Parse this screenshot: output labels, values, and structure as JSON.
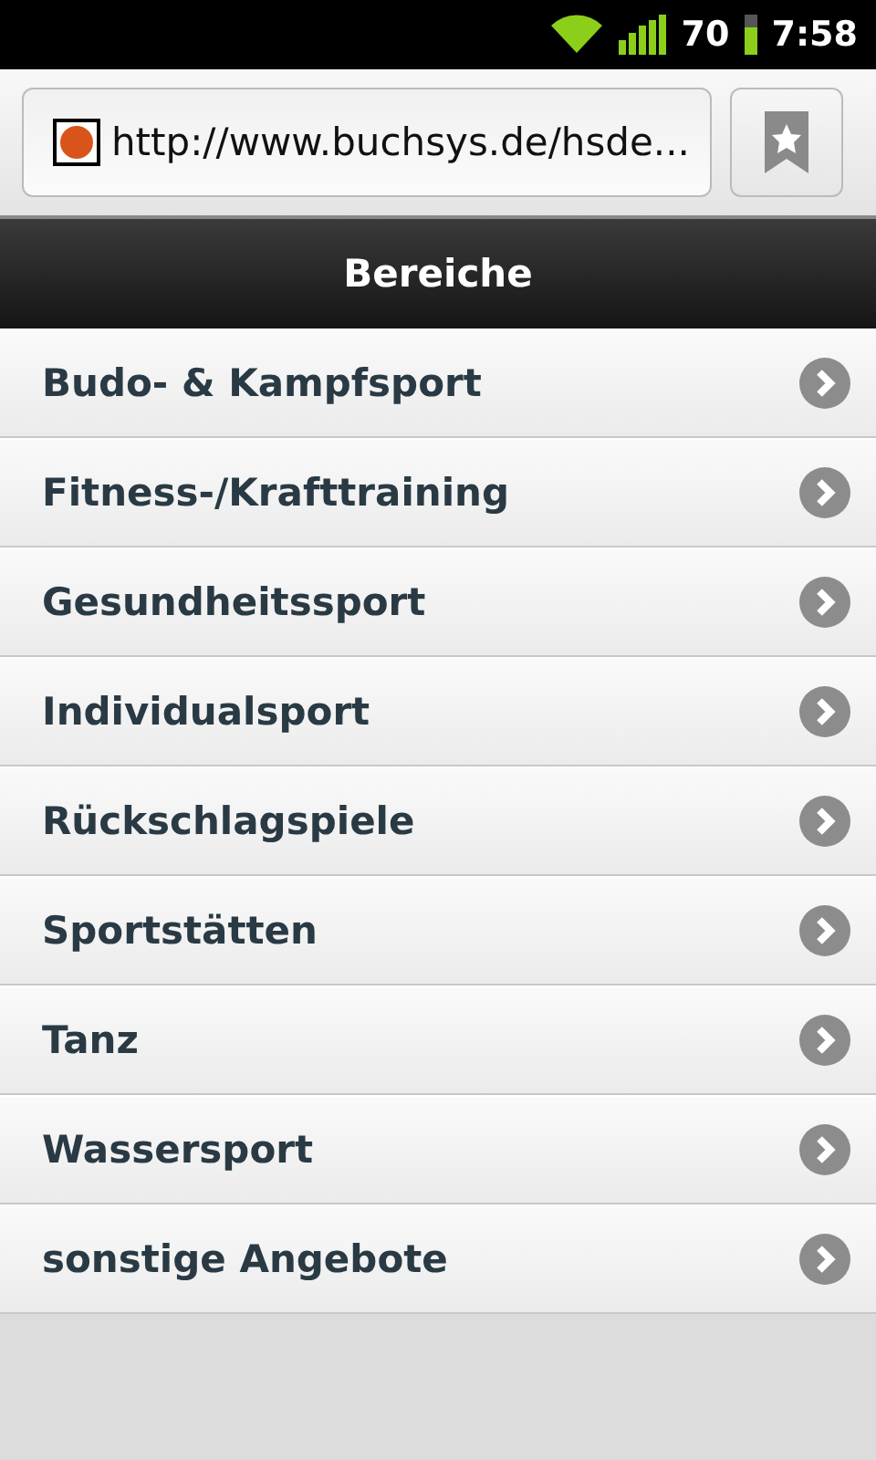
{
  "status_bar": {
    "battery": "70",
    "time": "7:58"
  },
  "address_bar": {
    "url": "http://www.buchsys.de/hsde..."
  },
  "header": {
    "title": "Bereiche"
  },
  "items": [
    {
      "label": "Budo- & Kampfsport"
    },
    {
      "label": "Fitness-/Krafttraining"
    },
    {
      "label": "Gesundheitssport"
    },
    {
      "label": "Individualsport"
    },
    {
      "label": "Rückschlagspiele"
    },
    {
      "label": "Sportstätten"
    },
    {
      "label": "Tanz"
    },
    {
      "label": "Wassersport"
    },
    {
      "label": "sonstige Angebote"
    }
  ]
}
